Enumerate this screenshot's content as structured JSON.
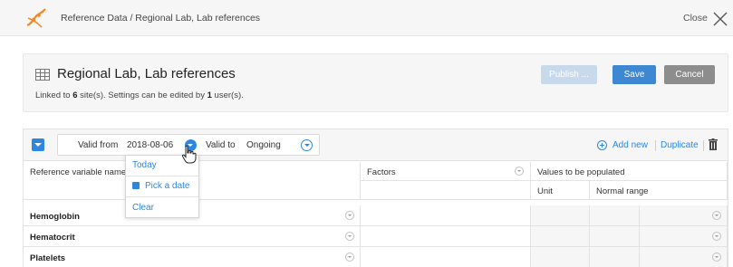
{
  "topbar": {
    "breadcrumb": "Reference Data / Regional Lab, Lab references",
    "close_label": "Close"
  },
  "header": {
    "title": "Regional Lab, Lab references",
    "linked_prefix": "Linked to ",
    "site_count": "6",
    "linked_mid": " site(s). Settings can be edited by ",
    "user_count": "1",
    "linked_suffix": " user(s).",
    "publish_label": "Publish ...",
    "save_label": "Save",
    "cancel_label": "Cancel"
  },
  "toolbar": {
    "valid_from_label": "Valid from",
    "valid_from_value": "2018-08-06",
    "valid_to_label": "Valid to",
    "valid_to_value": "Ongoing",
    "add_new_label": "Add new",
    "duplicate_label": "Duplicate"
  },
  "date_popup": {
    "today": "Today",
    "pick_date": "Pick a date",
    "clear": "Clear"
  },
  "table": {
    "col_reference": "Reference variable name",
    "col_factors": "Factors",
    "col_values": "Values to be populated",
    "col_unit": "Unit",
    "col_normal_range": "Normal range",
    "rows": [
      {
        "name": "Hemoglobin"
      },
      {
        "name": "Hematocrit"
      },
      {
        "name": "Platelets"
      }
    ]
  },
  "colors": {
    "accent": "#2e86de",
    "save": "#3d87d3",
    "cancel": "#8d8d8d",
    "publish_disabled": "#c9d9ec",
    "logo": "#f08a24"
  },
  "icons": [
    "logo-icon",
    "close-icon",
    "table-icon",
    "dropdown-icon",
    "calendar-icon",
    "hand-cursor-icon",
    "add-icon",
    "trash-icon",
    "chevron-down-icon",
    "minus-icon"
  ]
}
